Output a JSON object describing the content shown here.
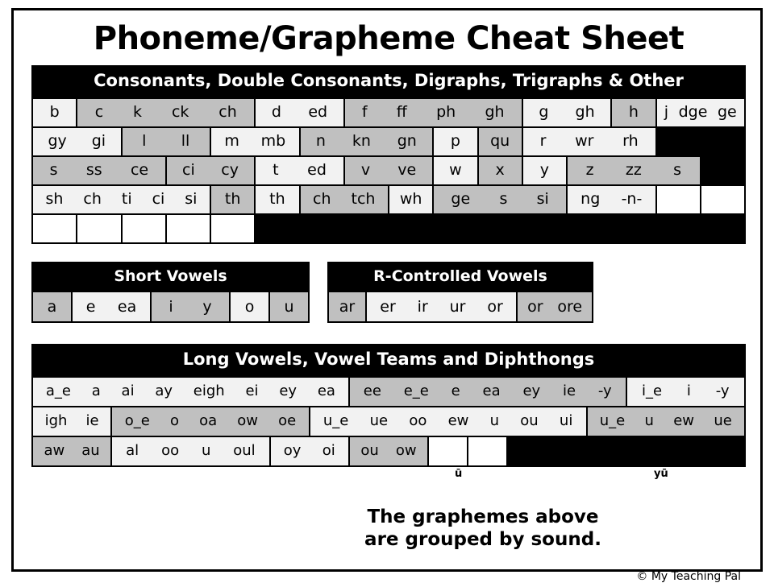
{
  "page": {
    "title": "Phoneme/Grapheme Cheat Sheet",
    "note_line1": "The graphemes above",
    "note_line2": "are grouped by sound.",
    "copyright": "© My Teaching Pal"
  },
  "colors": {
    "banner_bg": "#000000",
    "banner_text": "#ffffff",
    "cell_light": "#f2f2f2",
    "cell_shaded": "#c0c0c0",
    "cell_blank": "#ffffff",
    "border": "#000000"
  },
  "consonants": {
    "heading": "Consonants, Double Consonants, Digraphs, Trigraphs & Other",
    "columns": 16,
    "rows": [
      [
        {
          "graphemes": [
            "b"
          ],
          "span": 1,
          "shade": "light"
        },
        {
          "graphemes": [
            "c",
            "k",
            "ck",
            "ch"
          ],
          "span": 4,
          "shade": "shaded"
        },
        {
          "graphemes": [
            "d",
            "ed"
          ],
          "span": 2,
          "shade": "light"
        },
        {
          "graphemes": [
            "f",
            "ff",
            "ph",
            "gh"
          ],
          "span": 4,
          "shade": "shaded"
        },
        {
          "graphemes": [
            "g",
            "gh"
          ],
          "span": 2,
          "shade": "light"
        },
        {
          "graphemes": [
            "h"
          ],
          "span": 1,
          "shade": "shaded"
        },
        {
          "graphemes": [
            "j",
            "dge",
            "ge"
          ],
          "span": 2,
          "shade": "light"
        }
      ],
      [
        {
          "graphemes": [
            "gy",
            "gi"
          ],
          "span": 2,
          "shade": "light"
        },
        {
          "graphemes": [
            "l",
            "ll"
          ],
          "span": 2,
          "shade": "shaded"
        },
        {
          "graphemes": [
            "m",
            "mb"
          ],
          "span": 2,
          "shade": "light"
        },
        {
          "graphemes": [
            "n",
            "kn",
            "gn"
          ],
          "span": 3,
          "shade": "shaded"
        },
        {
          "graphemes": [
            "p"
          ],
          "span": 1,
          "shade": "light"
        },
        {
          "graphemes": [
            "qu"
          ],
          "span": 1,
          "shade": "shaded"
        },
        {
          "graphemes": [
            "r",
            "wr",
            "rh"
          ],
          "span": 3,
          "shade": "light"
        },
        {
          "graphemes": [
            "s",
            "ss",
            "ce"
          ],
          "span": 3,
          "shade": "shaded"
        }
      ],
      [
        {
          "graphemes": [
            "ci",
            "cy"
          ],
          "span": 2,
          "shade": "shaded"
        },
        {
          "graphemes": [
            "t",
            "ed"
          ],
          "span": 2,
          "shade": "light"
        },
        {
          "graphemes": [
            "v",
            "ve"
          ],
          "span": 2,
          "shade": "shaded"
        },
        {
          "graphemes": [
            "w"
          ],
          "span": 1,
          "shade": "light"
        },
        {
          "graphemes": [
            "x"
          ],
          "span": 1,
          "shade": "shaded"
        },
        {
          "graphemes": [
            "y"
          ],
          "span": 1,
          "shade": "light"
        },
        {
          "graphemes": [
            "z",
            "zz",
            "s"
          ],
          "span": 3,
          "shade": "shaded"
        },
        {
          "graphemes": [
            "sh",
            "ch",
            "ti",
            "ci",
            "si"
          ],
          "span": 4,
          "shade": "light"
        }
      ],
      [
        {
          "graphemes": [
            "th"
          ],
          "span": 1,
          "shade": "shaded"
        },
        {
          "graphemes": [
            "th"
          ],
          "span": 1,
          "shade": "light"
        },
        {
          "graphemes": [
            "ch",
            "tch"
          ],
          "span": 2,
          "shade": "shaded"
        },
        {
          "graphemes": [
            "wh"
          ],
          "span": 1,
          "shade": "light"
        },
        {
          "graphemes": [
            "ge",
            "s",
            "si"
          ],
          "span": 3,
          "shade": "shaded"
        },
        {
          "graphemes": [
            "ng",
            "-n-"
          ],
          "span": 2,
          "shade": "light"
        },
        {
          "graphemes": [],
          "span": 1,
          "shade": "blank"
        },
        {
          "graphemes": [],
          "span": 1,
          "shade": "blank"
        },
        {
          "graphemes": [],
          "span": 1,
          "shade": "blank"
        },
        {
          "graphemes": [],
          "span": 1,
          "shade": "blank"
        },
        {
          "graphemes": [],
          "span": 1,
          "shade": "blank"
        },
        {
          "graphemes": [],
          "span": 1,
          "shade": "blank"
        },
        {
          "graphemes": [],
          "span": 1,
          "shade": "blank"
        }
      ]
    ]
  },
  "short_vowels": {
    "heading": "Short Vowels",
    "columns": 7,
    "rows": [
      [
        {
          "graphemes": [
            "a"
          ],
          "span": 1,
          "shade": "shaded"
        },
        {
          "graphemes": [
            "e",
            "ea"
          ],
          "span": 2,
          "shade": "light"
        },
        {
          "graphemes": [
            "i",
            "y"
          ],
          "span": 2,
          "shade": "shaded"
        },
        {
          "graphemes": [
            "o"
          ],
          "span": 1,
          "shade": "light"
        },
        {
          "graphemes": [
            "u"
          ],
          "span": 1,
          "shade": "shaded"
        }
      ]
    ]
  },
  "r_controlled_vowels": {
    "heading": "R-Controlled Vowels",
    "columns": 7,
    "rows": [
      [
        {
          "graphemes": [
            "ar"
          ],
          "span": 1,
          "shade": "shaded"
        },
        {
          "graphemes": [
            "er",
            "ir",
            "ur",
            "or"
          ],
          "span": 4,
          "shade": "light"
        },
        {
          "graphemes": [
            "or",
            "ore"
          ],
          "span": 2,
          "shade": "shaded"
        }
      ]
    ]
  },
  "long_vowels": {
    "heading": "Long Vowels, Vowel Teams and Diphthongs",
    "columns": 18,
    "rows": [
      [
        {
          "graphemes": [
            "a_e",
            "a",
            "ai",
            "ay",
            "eigh",
            "ei",
            "ey",
            "ea"
          ],
          "span": 8,
          "shade": "light"
        },
        {
          "graphemes": [
            "ee",
            "e_e",
            "e",
            "ea",
            "ey",
            "ie",
            "-y"
          ],
          "span": 7,
          "shade": "shaded"
        },
        {
          "graphemes": [
            "i_e",
            "i",
            "-y"
          ],
          "span": 3,
          "shade": "light"
        }
      ],
      [
        {
          "graphemes": [
            "igh",
            "ie"
          ],
          "span": 2,
          "shade": "light"
        },
        {
          "graphemes": [
            "o_e",
            "o",
            "oa",
            "ow",
            "oe"
          ],
          "span": 5,
          "shade": "shaded"
        },
        {
          "graphemes": [
            "u_e",
            "ue",
            "oo",
            "ew",
            "u",
            "ou",
            "ui"
          ],
          "span": 7,
          "shade": "light"
        },
        {
          "graphemes": [
            "u_e",
            "u",
            "ew",
            "ue"
          ],
          "span": 4,
          "shade": "shaded"
        }
      ],
      [
        {
          "graphemes": [
            "aw",
            "au"
          ],
          "span": 2,
          "shade": "shaded"
        },
        {
          "graphemes": [
            "al",
            "oo",
            "u",
            "oul"
          ],
          "span": 4,
          "shade": "light"
        }
      ],
      [
        {
          "graphemes": [
            "oy",
            "oi"
          ],
          "span": 2,
          "shade": "light"
        },
        {
          "graphemes": [
            "ou",
            "ow"
          ],
          "span": 2,
          "shade": "shaded"
        },
        {
          "graphemes": [],
          "span": 1,
          "shade": "blank"
        },
        {
          "graphemes": [],
          "span": 1,
          "shade": "blank"
        }
      ]
    ],
    "annotations": [
      {
        "symbol": "ū",
        "name": "annot-u"
      },
      {
        "symbol": "yū",
        "name": "annot-yu"
      }
    ]
  }
}
